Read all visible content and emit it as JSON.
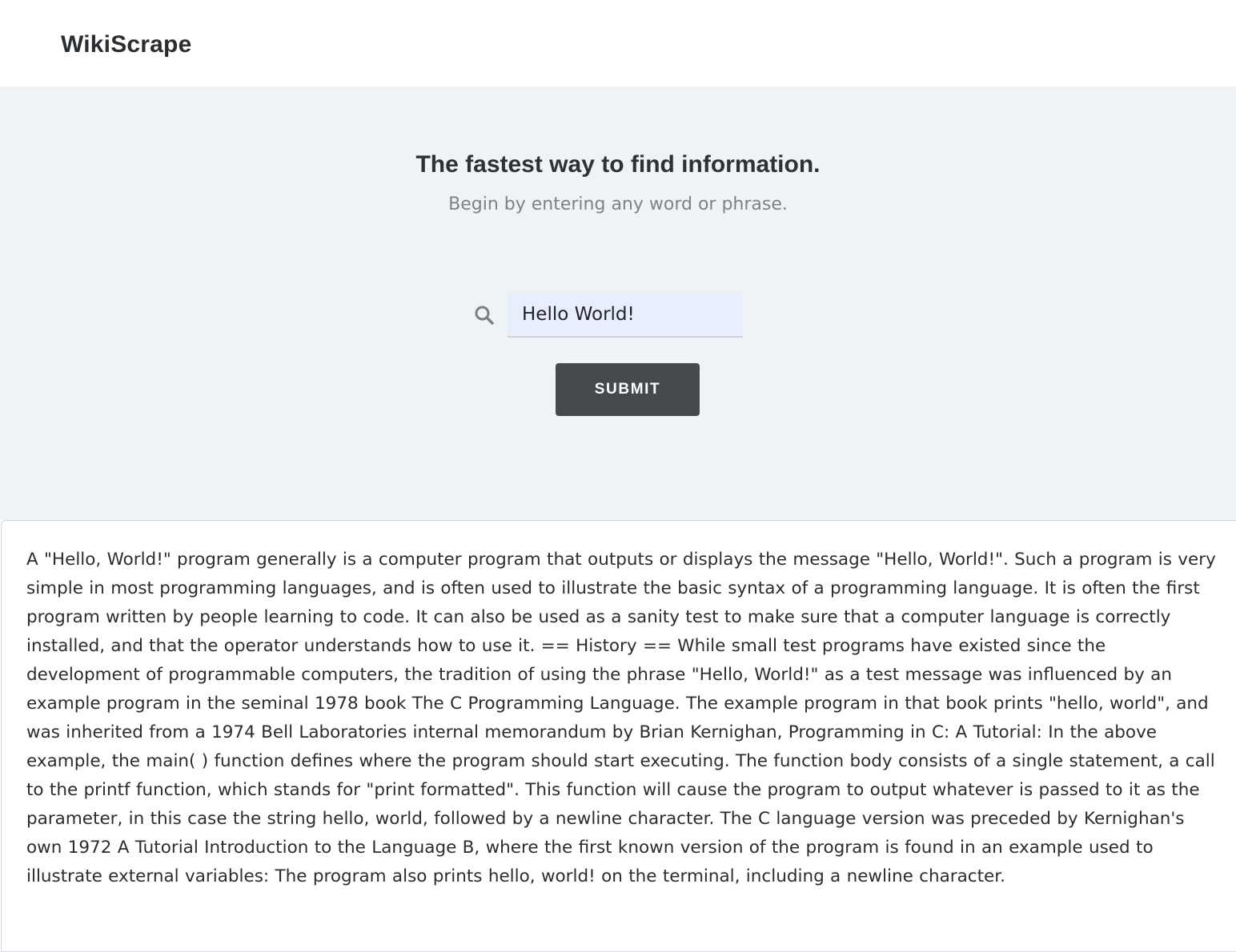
{
  "navbar": {
    "brand": "WikiScrape"
  },
  "hero": {
    "headline": "The fastest way to find information.",
    "subhead": "Begin by entering any word or phrase.",
    "search": {
      "icon": "search-icon",
      "value": "Hello World!"
    },
    "submit_label": "SUBMIT"
  },
  "result": {
    "text": "A \"Hello, World!\" program generally is a computer program that outputs or displays the message \"Hello, World!\". Such a program is very simple in most programming languages, and is often used to illustrate the basic syntax of a programming language. It is often the first program written by people learning to code. It can also be used as a sanity test to make sure that a computer language is correctly installed, and that the operator understands how to use it. == History == While small test programs have existed since the development of programmable computers, the tradition of using the phrase \"Hello, World!\" as a test message was influenced by an example program in the seminal 1978 book The C Programming Language. The example program in that book prints \"hello, world\", and was inherited from a 1974 Bell Laboratories internal memorandum by Brian Kernighan, Programming in C: A Tutorial: In the above example, the main( ) function defines where the program should start executing. The function body consists of a single statement, a call to the printf function, which stands for \"print formatted\". This function will cause the program to output whatever is passed to it as the parameter, in this case the string hello, world, followed by a newline character. The C language version was preceded by Kernighan's own 1972 A Tutorial Introduction to the Language B, where the first known version of the program is found in an example used to illustrate external variables: The program also prints hello, world! on the terminal, including a newline character."
  },
  "colors": {
    "hero_background": "#eef3f6",
    "input_background": "#e8eefb",
    "button_background": "#45494d",
    "button_text": "#ffffff",
    "text": "#2a2d30",
    "muted_text": "#7d8287"
  }
}
